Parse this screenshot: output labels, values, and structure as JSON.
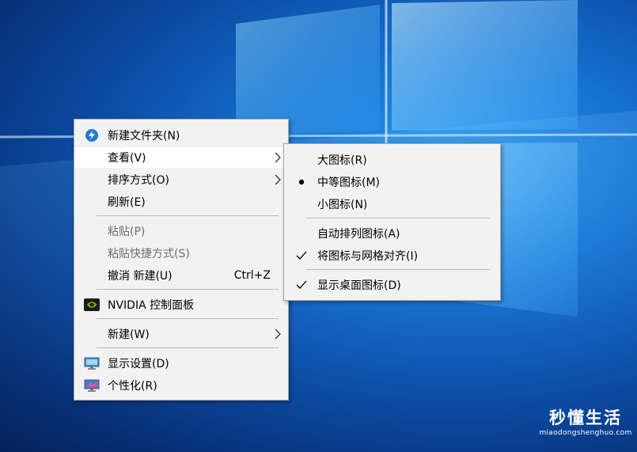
{
  "context_menu": {
    "items": [
      {
        "label": "新建文件夹(N)",
        "icon": "new-folder-icon"
      },
      {
        "label": "查看(V)",
        "submenu": true,
        "highlighted": true
      },
      {
        "label": "排序方式(O)",
        "submenu": true
      },
      {
        "label": "刷新(E)"
      },
      {
        "label": "粘贴(P)",
        "disabled": true
      },
      {
        "label": "粘贴快捷方式(S)",
        "disabled": true
      },
      {
        "label": "撤消 新建(U)",
        "shortcut": "Ctrl+Z"
      },
      {
        "label": "NVIDIA 控制面板",
        "icon": "nvidia-icon"
      },
      {
        "label": "新建(W)",
        "submenu": true
      },
      {
        "label": "显示设置(D)",
        "icon": "display-settings-icon"
      },
      {
        "label": "个性化(R)",
        "icon": "personalize-icon"
      }
    ]
  },
  "view_submenu": {
    "items": [
      {
        "label": "大图标(R)"
      },
      {
        "label": "中等图标(M)",
        "mark": "bullet"
      },
      {
        "label": "小图标(N)"
      },
      {
        "label": "自动排列图标(A)"
      },
      {
        "label": "将图标与网格对齐(I)",
        "mark": "check"
      },
      {
        "label": "显示桌面图标(D)",
        "mark": "check"
      }
    ]
  },
  "watermark": {
    "title": "秒懂生活",
    "url": "miaodongshenghuo.com"
  },
  "colors": {
    "menu_background": "#f2f2f2",
    "highlight": "#ffffff",
    "disabled_text": "#6d6d6d",
    "desktop_blue": "#1673d2"
  }
}
